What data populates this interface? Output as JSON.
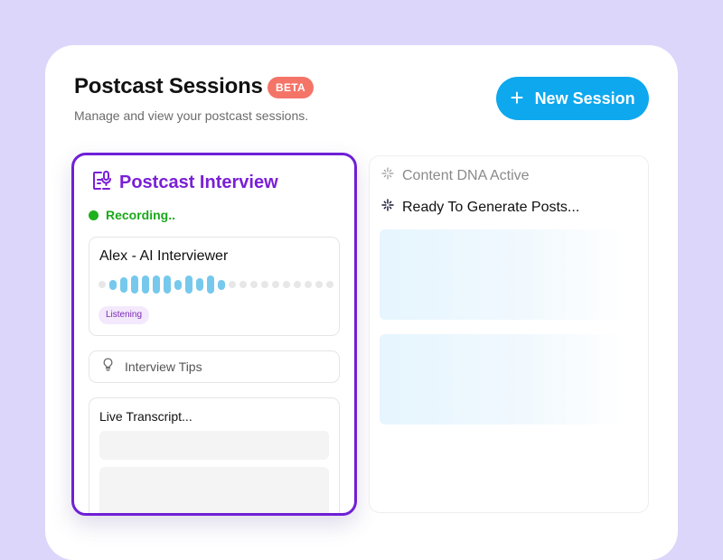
{
  "header": {
    "title": "Postcast Sessions",
    "badge": "BETA",
    "subtitle": "Manage and view your postcast sessions.",
    "new_session_label": "New Session"
  },
  "interview_panel": {
    "title": "Postcast Interview",
    "status": "Recording..",
    "status_color": "#1eb01e",
    "accent_color": "#6f1fd6",
    "interviewer": {
      "name": "Alex - AI Interviewer",
      "state": "Listening",
      "waveform_levels": [
        0,
        0.45,
        0.7,
        0.85,
        0.85,
        0.85,
        0.85,
        0.45,
        0.85,
        0.6,
        0.85,
        0.45,
        0,
        0,
        0,
        0,
        0,
        0,
        0,
        0,
        0,
        0
      ]
    },
    "tips_label": "Interview Tips",
    "transcript_label": "Live Transcript..."
  },
  "content_panel": {
    "dna_label": "Content DNA Active",
    "ready_label": "Ready To Generate Posts..."
  },
  "colors": {
    "primary_button": "#0ea8ee",
    "beta_badge": "#f47468",
    "background": "#dcd6fb"
  },
  "icons": {
    "new_session": "plus-icon",
    "interview": "document-mic-icon",
    "tips": "lightbulb-icon",
    "dna": "sparkle-icon",
    "ready": "sparkle-icon"
  }
}
